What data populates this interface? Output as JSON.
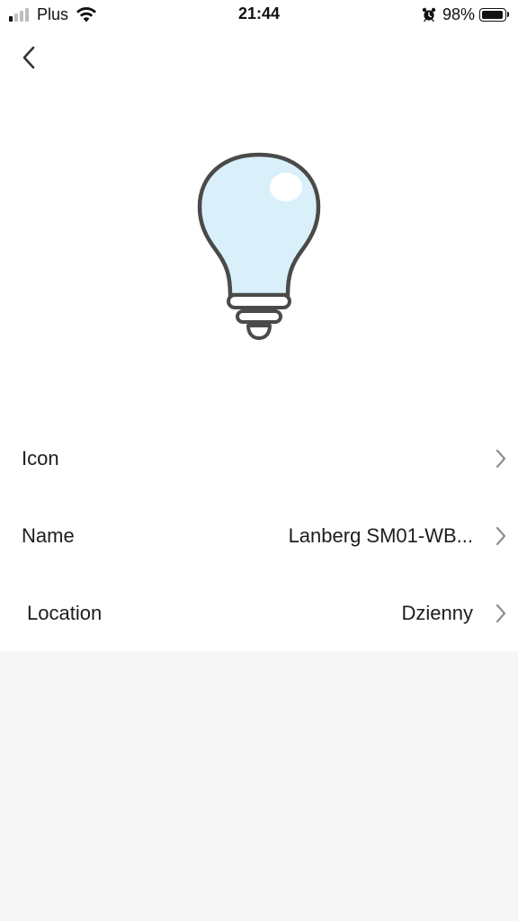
{
  "status_bar": {
    "carrier": "Plus",
    "time": "21:44",
    "battery_percent": "98%",
    "battery_level": 0.98,
    "signal_bars_active": 1,
    "signal_bars_total": 4,
    "icons": [
      "signal-icon",
      "wifi-icon",
      "alarm-icon",
      "battery-icon"
    ]
  },
  "nav": {
    "back_icon": "chevron-left-icon"
  },
  "device": {
    "icon": "light-bulb-icon",
    "bulb_fill_color": "#d9f0fb",
    "bulb_outline_color": "#4a4a4a"
  },
  "settings": {
    "rows": [
      {
        "label": "Icon",
        "value": ""
      },
      {
        "label": "Name",
        "value": "Lanberg SM01-WB..."
      },
      {
        "label": "Location",
        "value": "Dzienny"
      }
    ],
    "chevron_icon": "chevron-right-icon"
  },
  "colors": {
    "background_top": "#ffffff",
    "background_bottom": "#f6f6f6",
    "text": "#1d1d1d",
    "chevron": "#8e8e8e"
  }
}
